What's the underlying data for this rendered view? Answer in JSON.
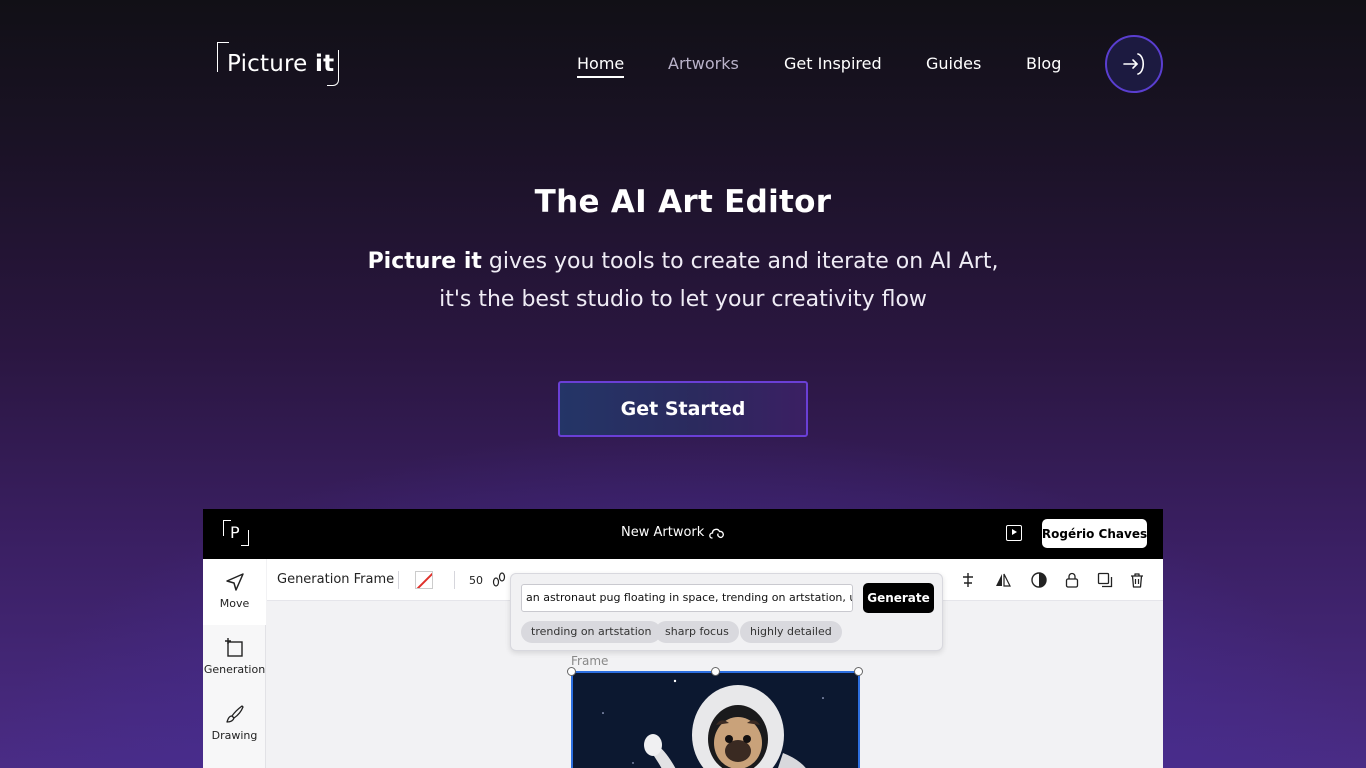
{
  "nav": {
    "logo_text": "Picture",
    "logo_bold": "it",
    "items": [
      {
        "label": "Home",
        "active": true
      },
      {
        "label": "Artworks",
        "active": false
      },
      {
        "label": "Get Inspired",
        "active": false
      },
      {
        "label": "Guides",
        "active": false
      },
      {
        "label": "Blog",
        "active": false
      }
    ],
    "login_icon": "sign-in-icon"
  },
  "hero": {
    "title": "The AI Art Editor",
    "subtitle_bold": "Picture it",
    "subtitle_rest": " gives you tools to create and iterate on AI Art,",
    "subtitle_line2": "it's the best studio to let your creativity flow",
    "cta_label": "Get Started"
  },
  "app_preview": {
    "logo_letter": "P",
    "artwork_title": "New Artwork",
    "user_name": "Rogério Chaves",
    "tools": [
      {
        "label": "Move",
        "icon": "cursor-arrow-icon",
        "selected": true
      },
      {
        "label": "Generation",
        "icon": "frame-plus-icon",
        "selected": false
      },
      {
        "label": "Drawing",
        "icon": "brush-icon",
        "selected": false
      }
    ],
    "toolbar": {
      "frame_label": "Generation Frame",
      "brush_size": "50"
    },
    "generate_popup": {
      "prompt": "an astronaut pug floating in space, trending on artstation, ultra real",
      "button_label": "Generate",
      "suggestions": [
        "trending on artstation",
        "sharp focus",
        "highly detailed"
      ]
    },
    "frame_label": "Frame"
  },
  "colors": {
    "accent_border": "#6a3fd6",
    "selection_blue": "#2d6fe0"
  }
}
